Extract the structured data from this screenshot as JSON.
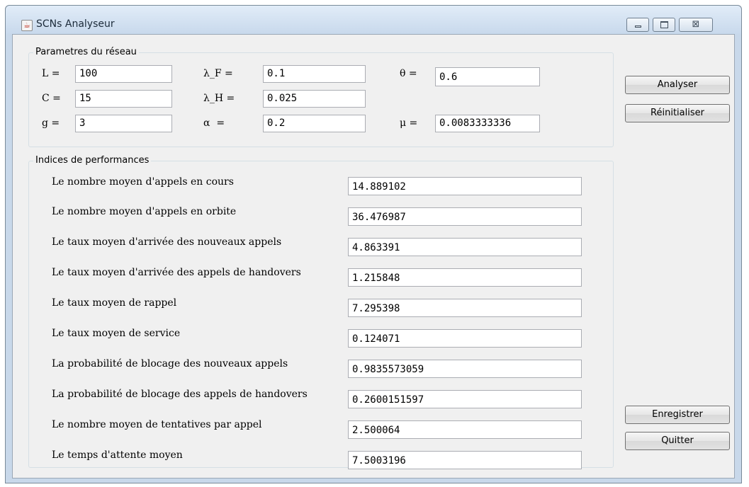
{
  "window": {
    "title": "SCNs Analyseur",
    "close_glyph": "⊠"
  },
  "params": {
    "legend": "Parametres du réseau",
    "L": {
      "label": "L =",
      "value": "100"
    },
    "C": {
      "label": "C =",
      "value": "15"
    },
    "g": {
      "label": "g =",
      "value": "3"
    },
    "lambda_F": {
      "label": "λ_F =",
      "value": "0.1"
    },
    "lambda_H": {
      "label": "λ_H =",
      "value": "0.025"
    },
    "alpha": {
      "label": "α  =",
      "value": "0.2"
    },
    "theta": {
      "label": "θ =",
      "value": "0.6"
    },
    "mu": {
      "label": "μ =",
      "value": "0.0083333336"
    }
  },
  "perf": {
    "legend": "Indices de performances",
    "rows": [
      {
        "label": "Le nombre moyen d'appels en cours",
        "value": "14.889102"
      },
      {
        "label": "Le nombre moyen d'appels en orbite",
        "value": "36.476987"
      },
      {
        "label": "Le taux moyen d'arrivée des nouveaux appels",
        "value": "4.863391"
      },
      {
        "label": "Le taux moyen d'arrivée des appels de handovers",
        "value": "1.215848"
      },
      {
        "label": "Le taux moyen de rappel",
        "value": "7.295398"
      },
      {
        "label": "Le taux moyen de service",
        "value": "0.124071"
      },
      {
        "label": "La probabilité de blocage des nouveaux appels",
        "value": "0.9835573059"
      },
      {
        "label": "La probabilité de blocage des appels de handovers",
        "value": "0.2600151597"
      },
      {
        "label": "Le nombre moyen de tentatives par appel",
        "value": "2.500064"
      },
      {
        "label": "Le temps d'attente moyen",
        "value": "7.5003196"
      }
    ]
  },
  "buttons": {
    "analyser": "Analyser",
    "reinitialiser": "Réinitialiser",
    "enregistrer": "Enregistrer",
    "quitter": "Quitter"
  },
  "icons": {
    "app": "java-cup-icon",
    "minimize": "minimize-icon",
    "maximize": "maximize-icon",
    "close": "close-icon"
  }
}
